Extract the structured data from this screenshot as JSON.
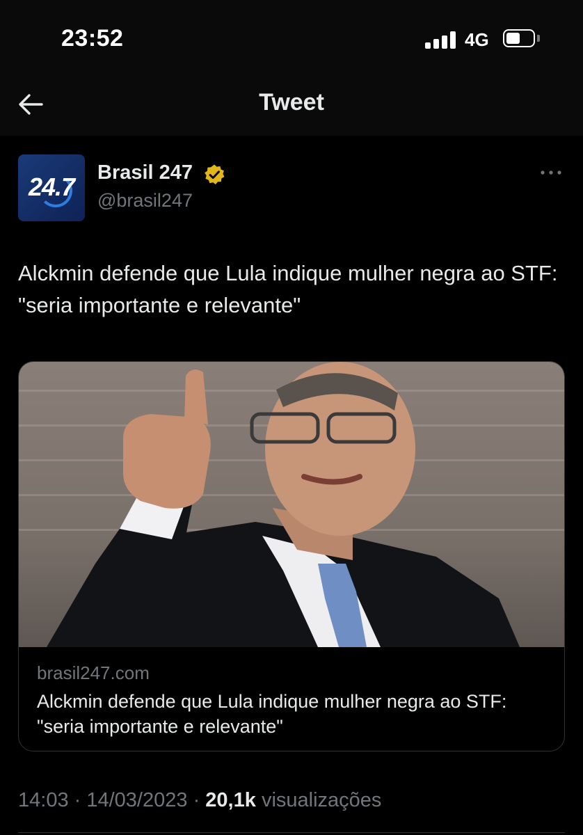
{
  "status_bar": {
    "time": "23:52",
    "network": "4G",
    "battery_level": 0.55
  },
  "header": {
    "title": "Tweet",
    "back_icon": "arrow-left-icon"
  },
  "tweet": {
    "avatar_text": "24.7",
    "display_name": "Brasil 247",
    "handle": "@brasil247",
    "verified_badge_color": "#e2b719",
    "text": "Alckmin defende que Lula indique mulher negra ao STF: \"seria importante e relevante\"",
    "card": {
      "domain": "brasil247.com",
      "title": "Alckmin defende que Lula indique mulher negra ao STF: \"seria importante e relevante\""
    },
    "time": "14:03",
    "date": "14/03/2023",
    "views_count": "20,1k",
    "views_label": "visualizações"
  },
  "colors": {
    "background": "#000000",
    "text_primary": "#e7e9ea",
    "text_secondary": "#71767b",
    "border": "#2f3336"
  }
}
